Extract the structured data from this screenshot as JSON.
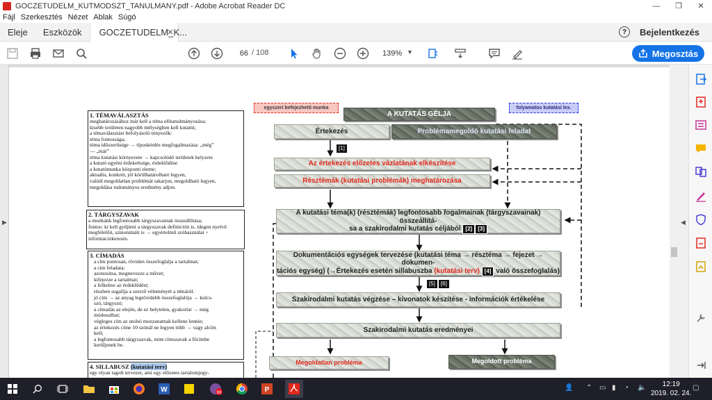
{
  "window": {
    "title": "GOCZETUDELM_KUTMODSZT_TANULMANY.pdf - Adobe Acrobat Reader DC",
    "minimize": "—",
    "restore": "❐",
    "close": "✕"
  },
  "menu": [
    "Fájl",
    "Szerkesztés",
    "Nézet",
    "Ablak",
    "Súgó"
  ],
  "tabs": {
    "home": "Eleje",
    "tools": "Eszközök",
    "document": "GOCZETUDELM_K...",
    "close": "✕",
    "help": "?",
    "signin": "Bejelentkezés"
  },
  "toolbar": {
    "page_current": "66",
    "page_separator": "/",
    "page_total": "108",
    "zoom": "139%",
    "share": "Megosztás"
  },
  "document": {
    "left_boxes": [
      {
        "heading": "1. TÉMAVÁLASZTÁS",
        "lines": [
          "meghatározásához már kell a téma előtanulmányozása;",
          "kisebb területen nagyobb mélységben kell kutatni;",
          "a témaválasztást befolyásoló tényezők:",
          "téma fontossága;",
          "téma időszerűsége → típuskérdés megfogalmazása: „még”",
          "— „már”",
          "téma kutatási környezete → kapcsolódó területek helyzete",
          "a kutató egyéni érdekeltsége, érdeklődése",
          "a kutatómunka központi eleme;",
          "aktuális, konkrét, jól körülhatárolható legyen,",
          "valódi megoldatlan problémát takarjon, megoldható legyen,",
          "megoldása tudományos eredmény adjon."
        ]
      },
      {
        "heading": "2. TÁRGYSZAVAK",
        "lines": [
          "a munkánk legfontosabb tárgyszavainak összeállítása;",
          "fontos: ki kell gyűjteni a tárgyszavak definícióit is, idegen nyelvű",
          "megfelelőit, szinonimáit is → egyértelmű szóhasználat +",
          "információkeresés."
        ]
      },
      {
        "heading": "3. CÍMADÁS",
        "lines": [
          "a cím pontosan, röviden összefoglalja a tartalmat;",
          "a cím feladata:",
          "azonosítsa, megnevezze a művet;",
          "kifejezze a tartalmat;",
          "a felkeltse az érdeklődést;",
          "részben sugallja a szerző véleményét a témáról.",
          "jó cím → az anyag legrövidebb összefoglalója → kulcs-",
          "szó, tárgyszó;",
          "a címadás az elején, de ez helytelen, gyakorlat → még",
          "módosulhat;",
          "végleges cím az utolsó mozzanatnak kellene lennie;",
          "az értekezés címe 10 szónál ne legyen több → vagy alcím",
          "kell;",
          "a legfontosabb tárgyszavak, mint címszavak a főcímbe",
          "kerüljenek be."
        ]
      },
      {
        "heading": "4. SILLABUSZ",
        "heading_highlight": "(kutatási terv)",
        "lines": [
          "egy olyan tagolt tervezet, ami egy előzetes tartalomjegy-"
        ]
      }
    ],
    "legend_red": "egyszeri befejezhető munka",
    "legend_blue": "folyamatos kutatási lex.",
    "gel_title": "A KUTATÁS GÉLJA",
    "ertekezes": "Értekezés",
    "problemamegoldo": "Problémamegoldó kutatási feladat",
    "tag1": "[1]",
    "vazlat": "Az értekezés előzetes vázlatának elkészítése",
    "resztemak": "Résztémák (kutatási problémák) meghatározása",
    "fogalmak_line1": "A kutatási téma(k) (résztémák) legfontosabb fogalmainak (tárgyszavainak) összeállítá-",
    "fogalmak_line2": "sa a szakirodalmi kutatás céljából",
    "tag2": "[2]",
    "tag3": "[3]",
    "dok_line1": "Dokumentációs egységek tervezése (kutatási téma → résztéma → fejezet → dokumen-",
    "dok_line2a": "tációs egység) (→Értekezés esetén sillabuszba",
    "dok_line2b": "(kutatási terv)",
    "tag4": "[4]",
    "dok_line2c": "való összefoglalás)",
    "tag5": "[5]",
    "tag6": "[6]",
    "szakirodalmi": "Szakirodalmi kutatás végzése – kivonatok készítése - információk értékelése",
    "eredmenyei": "Szakirodalmi kutatás eredményei",
    "megoldatlan": "Megoldatlan probléma",
    "megoldott": "Megoldott probléma"
  },
  "taskbar": {
    "time": "12:19",
    "date": "2019. 02. 24.",
    "badge": "99"
  }
}
